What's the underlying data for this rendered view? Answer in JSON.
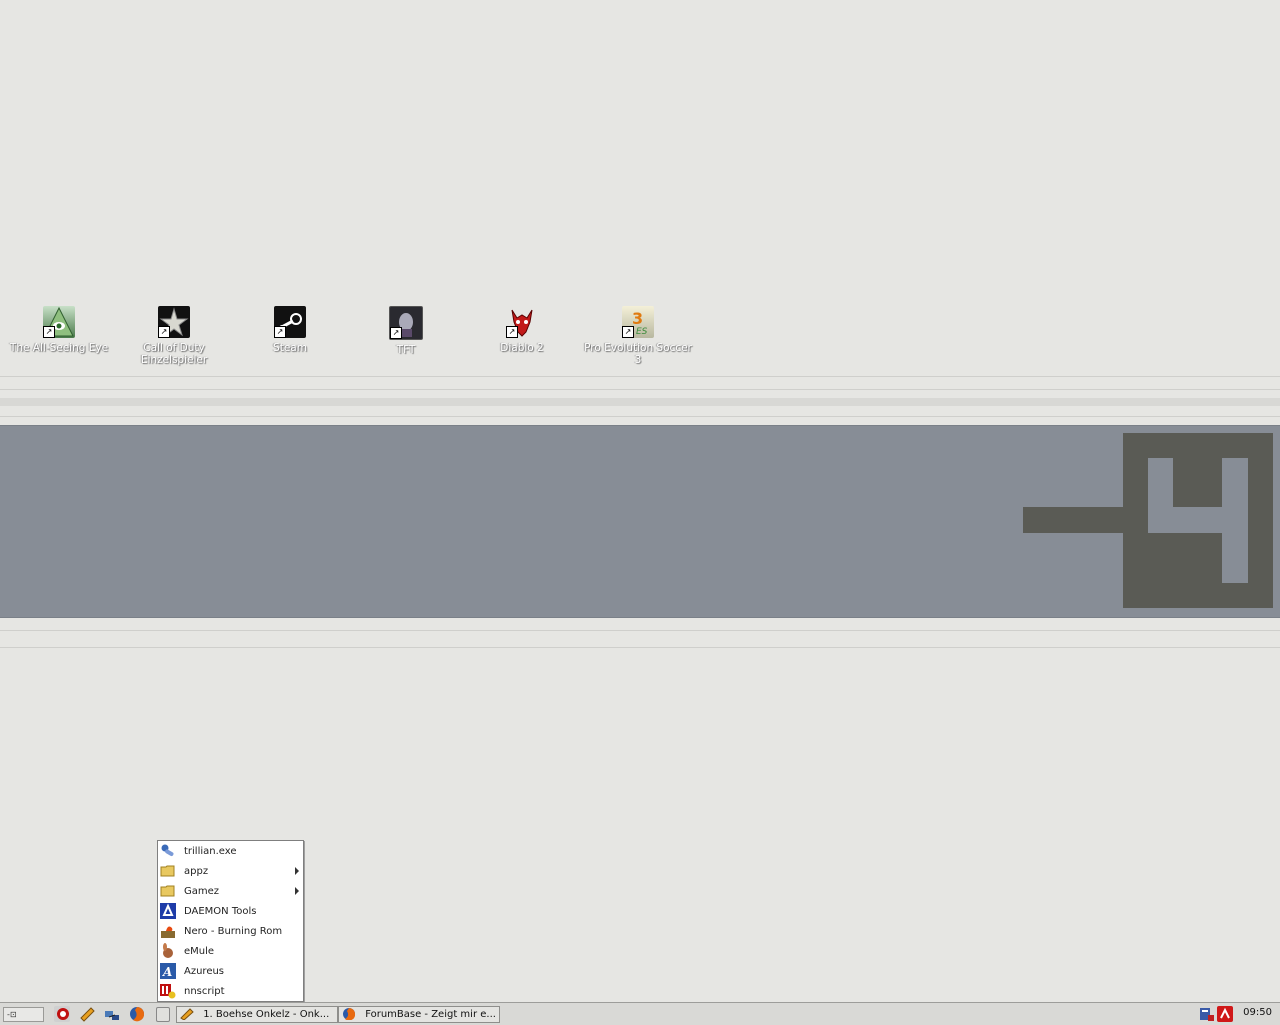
{
  "desktop": {
    "icons": [
      {
        "label": "The All-Seeing Eye",
        "icon": "eye-pyramid-icon"
      },
      {
        "label": "Call of Duty Einzelspieler",
        "icon": "star-medal-icon"
      },
      {
        "label": "Steam",
        "icon": "steam-icon"
      },
      {
        "label": "TFT",
        "icon": "warcraft-portrait-icon"
      },
      {
        "label": "Diablo 2",
        "icon": "diablo-demon-icon"
      },
      {
        "label": "Pro Evolution Soccer 3",
        "icon": "pes3-icon"
      }
    ],
    "shortcut_glyph": "↗"
  },
  "menu": {
    "items": [
      {
        "label": "trillian.exe",
        "icon": "trillian-icon"
      },
      {
        "label": "appz",
        "icon": "folder-icon",
        "submenu": true
      },
      {
        "label": "Gamez",
        "icon": "folder-icon",
        "submenu": true
      },
      {
        "label": "DAEMON Tools",
        "icon": "daemon-tools-icon"
      },
      {
        "label": "Nero - Burning Rom",
        "icon": "nero-icon"
      },
      {
        "label": "eMule",
        "icon": "emule-icon"
      },
      {
        "label": "Azureus",
        "icon": "azureus-icon"
      },
      {
        "label": "nnscript",
        "icon": "nnscript-icon"
      }
    ]
  },
  "taskbar": {
    "start_label": "-⊡",
    "tasks": [
      {
        "label": "1. Boehse Onkelz - Onk...",
        "icon": "winamp-icon"
      },
      {
        "label": "ForumBase - Zeigt mir e...",
        "icon": "firefox-icon"
      }
    ],
    "clock": "09:50"
  },
  "colors": {
    "desktop_bg": "#e6e6e3",
    "band": "#878d96",
    "logo": "#5a5b55"
  }
}
